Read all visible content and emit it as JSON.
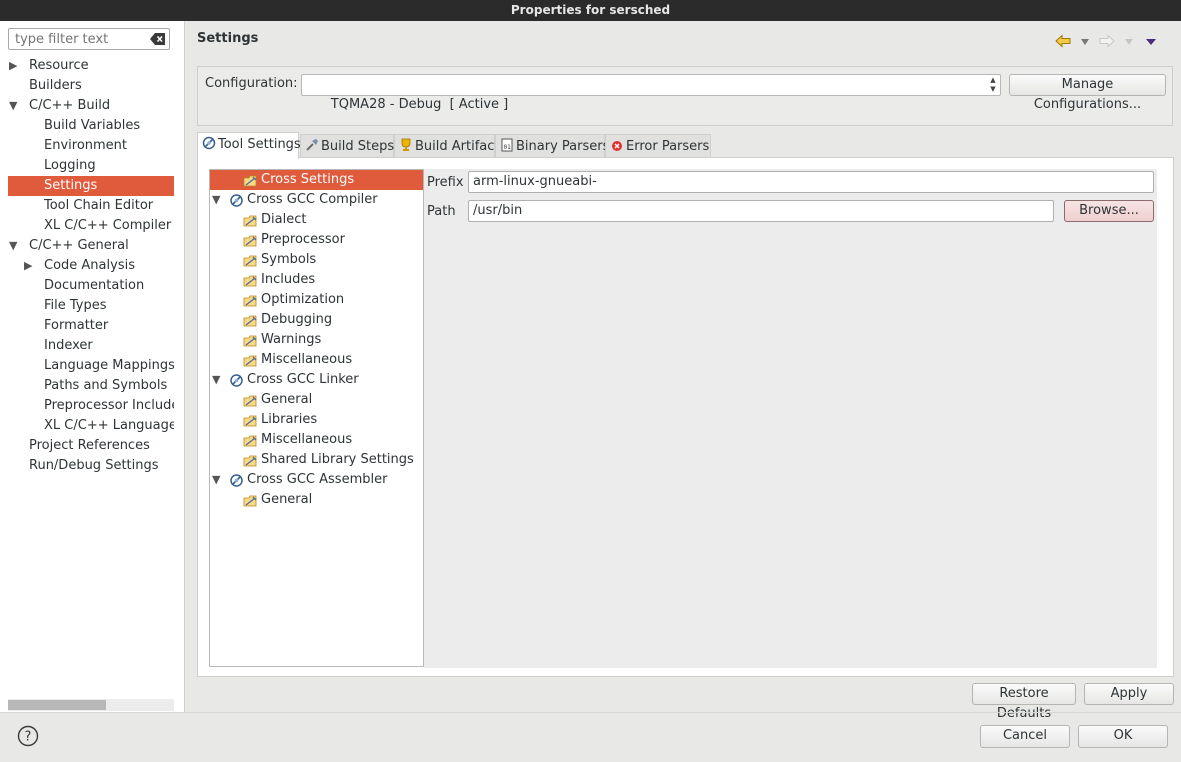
{
  "window": {
    "title": "Properties for sersched"
  },
  "filter": {
    "placeholder": "type filter text"
  },
  "nav": {
    "items": [
      {
        "label": "Resource",
        "indent": 0,
        "expander": "collapsed"
      },
      {
        "label": "Builders",
        "indent": 0,
        "expander": "none"
      },
      {
        "label": "C/C++ Build",
        "indent": 0,
        "expander": "expanded"
      },
      {
        "label": "Build Variables",
        "indent": 1,
        "expander": "none"
      },
      {
        "label": "Environment",
        "indent": 1,
        "expander": "none"
      },
      {
        "label": "Logging",
        "indent": 1,
        "expander": "none"
      },
      {
        "label": "Settings",
        "indent": 1,
        "expander": "none",
        "selected": true
      },
      {
        "label": "Tool Chain Editor",
        "indent": 1,
        "expander": "none"
      },
      {
        "label": "XL C/C++ Compiler",
        "indent": 1,
        "expander": "none"
      },
      {
        "label": "C/C++ General",
        "indent": 0,
        "expander": "expanded"
      },
      {
        "label": "Code Analysis",
        "indent": 1,
        "expander": "collapsed"
      },
      {
        "label": "Documentation",
        "indent": 1,
        "expander": "none"
      },
      {
        "label": "File Types",
        "indent": 1,
        "expander": "none"
      },
      {
        "label": "Formatter",
        "indent": 1,
        "expander": "none"
      },
      {
        "label": "Indexer",
        "indent": 1,
        "expander": "none"
      },
      {
        "label": "Language Mappings",
        "indent": 1,
        "expander": "none"
      },
      {
        "label": "Paths and Symbols",
        "indent": 1,
        "expander": "none"
      },
      {
        "label": "Preprocessor Include",
        "indent": 1,
        "expander": "none"
      },
      {
        "label": "XL C/C++ Language (",
        "indent": 1,
        "expander": "none"
      },
      {
        "label": "Project References",
        "indent": 0,
        "expander": "none"
      },
      {
        "label": "Run/Debug Settings",
        "indent": 0,
        "expander": "none"
      }
    ]
  },
  "page": {
    "title": "Settings"
  },
  "config": {
    "label": "Configuration:",
    "value": "TQMA28 - Debug  [ Active ]",
    "manage_button": "Manage Configurations..."
  },
  "tabs": [
    {
      "label": "Tool Settings",
      "icon": "tool-settings-icon",
      "active": true
    },
    {
      "label": "Build Steps",
      "icon": "build-steps-icon"
    },
    {
      "label": "Build Artifact",
      "icon": "build-artifact-icon"
    },
    {
      "label": "Binary Parsers",
      "icon": "binary-parsers-icon"
    },
    {
      "label": "Error Parsers",
      "icon": "error-parsers-icon"
    }
  ],
  "tool_tree": [
    {
      "label": "Cross Settings",
      "level": 1,
      "kind": "option",
      "selected": true
    },
    {
      "label": "Cross GCC Compiler",
      "level": 0,
      "kind": "tool"
    },
    {
      "label": "Dialect",
      "level": 1,
      "kind": "option"
    },
    {
      "label": "Preprocessor",
      "level": 1,
      "kind": "option"
    },
    {
      "label": "Symbols",
      "level": 1,
      "kind": "option"
    },
    {
      "label": "Includes",
      "level": 1,
      "kind": "option"
    },
    {
      "label": "Optimization",
      "level": 1,
      "kind": "option"
    },
    {
      "label": "Debugging",
      "level": 1,
      "kind": "option"
    },
    {
      "label": "Warnings",
      "level": 1,
      "kind": "option"
    },
    {
      "label": "Miscellaneous",
      "level": 1,
      "kind": "option"
    },
    {
      "label": "Cross GCC Linker",
      "level": 0,
      "kind": "tool"
    },
    {
      "label": "General",
      "level": 1,
      "kind": "option"
    },
    {
      "label": "Libraries",
      "level": 1,
      "kind": "option"
    },
    {
      "label": "Miscellaneous",
      "level": 1,
      "kind": "option"
    },
    {
      "label": "Shared Library Settings",
      "level": 1,
      "kind": "option"
    },
    {
      "label": "Cross GCC Assembler",
      "level": 0,
      "kind": "tool"
    },
    {
      "label": "General",
      "level": 1,
      "kind": "option"
    }
  ],
  "options": {
    "prefix_label": "Prefix",
    "prefix_value": "arm-linux-gnueabi-",
    "path_label": "Path",
    "path_value": "/usr/bin",
    "browse_button": "Browse..."
  },
  "buttons": {
    "restore_defaults": "Restore Defaults",
    "apply": "Apply",
    "cancel": "Cancel",
    "ok": "OK"
  },
  "colors": {
    "selection": "#e05a3c",
    "accent_arrow": "#d9a400"
  }
}
